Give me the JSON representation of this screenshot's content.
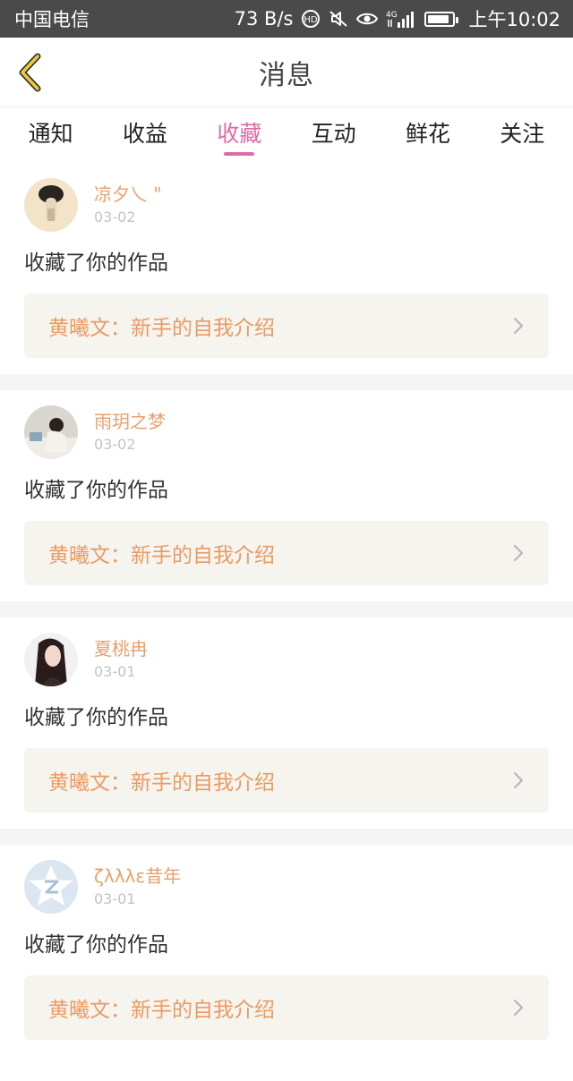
{
  "status_bar": {
    "carrier": "中国电信",
    "net_speed": "73 B/s",
    "network_label": "4G",
    "time": "上午10:02",
    "battery_level": 0.85
  },
  "header": {
    "title": "消息"
  },
  "tabs": [
    {
      "label": "通知",
      "active": false
    },
    {
      "label": "收益",
      "active": false
    },
    {
      "label": "收藏",
      "active": true
    },
    {
      "label": "互动",
      "active": false
    },
    {
      "label": "鲜花",
      "active": false
    },
    {
      "label": "关注",
      "active": false
    }
  ],
  "messages": [
    {
      "username": "凉夕乀 \"",
      "date": "03-02",
      "action": "收藏了你的作品",
      "work": "黄曦文：新手的自我介绍"
    },
    {
      "username": "雨玥之梦",
      "date": "03-02",
      "action": "收藏了你的作品",
      "work": "黄曦文：新手的自我介绍"
    },
    {
      "username": "夏桃冉",
      "date": "03-01",
      "action": "收藏了你的作品",
      "work": "黄曦文：新手的自我介绍"
    },
    {
      "username": "ζλλλε昔年",
      "date": "03-01",
      "action": "收藏了你的作品",
      "work": "黄曦文：新手的自我介绍"
    }
  ],
  "colors": {
    "accent_pink": "#e06aa6",
    "username_orange": "#e8a06e",
    "work_orange": "#eb9a62",
    "back_arrow_yellow": "#f0c93a"
  }
}
